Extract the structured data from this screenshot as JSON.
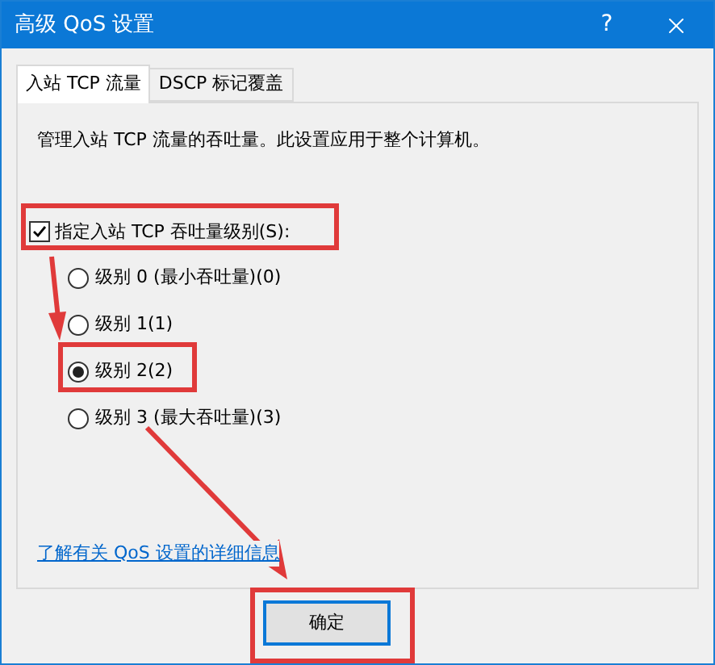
{
  "window": {
    "title": "高级 QoS 设置",
    "help": "?"
  },
  "tabs": [
    {
      "label": "入站 TCP 流量",
      "selected": true
    },
    {
      "label": "DSCP 标记覆盖",
      "selected": false
    }
  ],
  "description": "管理入站 TCP 流量的吞吐量。此设置应用于整个计算机。",
  "throttle": {
    "label": "指定入站 TCP 吞吐量级别(S):",
    "checked": true
  },
  "levels": [
    {
      "label": "级别 0 (最小吞吐量)(0)",
      "selected": false
    },
    {
      "label": "级别 1(1)",
      "selected": false
    },
    {
      "label": "级别 2(2)",
      "selected": true
    },
    {
      "label": "级别 3 (最大吞吐量)(3)",
      "selected": false
    }
  ],
  "link": "了解有关 QoS 设置的详细信息",
  "buttons": [
    "确定"
  ]
}
